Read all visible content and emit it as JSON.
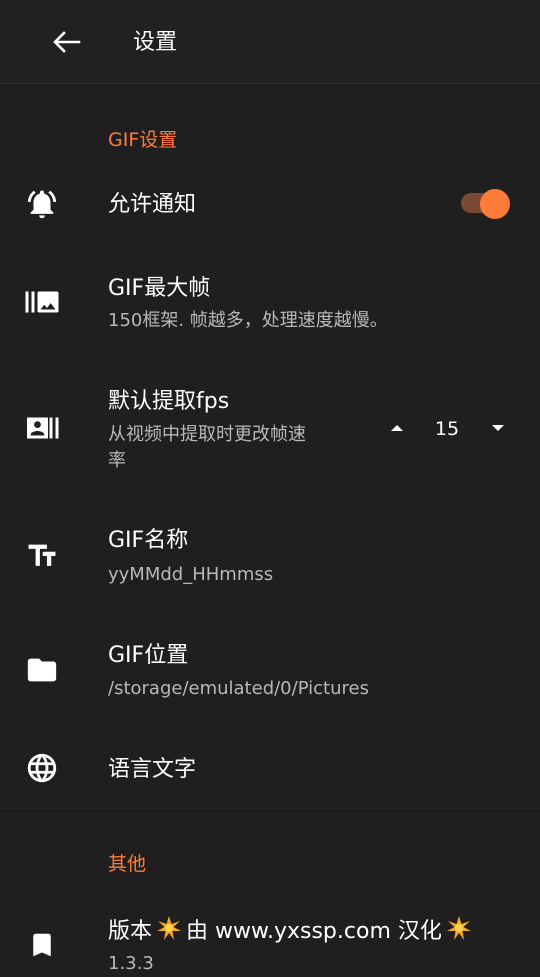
{
  "appbar": {
    "title": "设置"
  },
  "sections": {
    "gif": "GIF设置",
    "other": "其他"
  },
  "settings": {
    "notify": {
      "title": "允许通知",
      "enabled": true
    },
    "max_frames": {
      "title": "GIF最大帧",
      "subtitle": "150框架. 帧越多，处理速度越慢。"
    },
    "fps": {
      "title": "默认提取fps",
      "subtitle_line1": "从视频中提取时更改帧速",
      "subtitle_line2": "率",
      "value": "15"
    },
    "name": {
      "title": "GIF名称",
      "subtitle": "yyMMdd_HHmmss"
    },
    "location": {
      "title": "GIF位置",
      "subtitle": "/storage/emulated/0/Pictures"
    },
    "language": {
      "title": "语言文字"
    },
    "version": {
      "title_prefix": "版本",
      "title_middle": "由 www.yxssp.com 汉化",
      "subtitle": "1.3.3"
    }
  },
  "colors": {
    "accent": "#ff7b3a",
    "background": "#1f1f1f",
    "toggle_track": "#7a4a34"
  },
  "icons": {
    "back": "arrow-left-icon",
    "notify": "bell-ring-icon",
    "max_frames": "burst-mode-icon",
    "fps": "contact-card-icon",
    "name": "text-fields-icon",
    "location": "folder-icon",
    "language": "globe-icon",
    "version": "bookmark-icon"
  }
}
